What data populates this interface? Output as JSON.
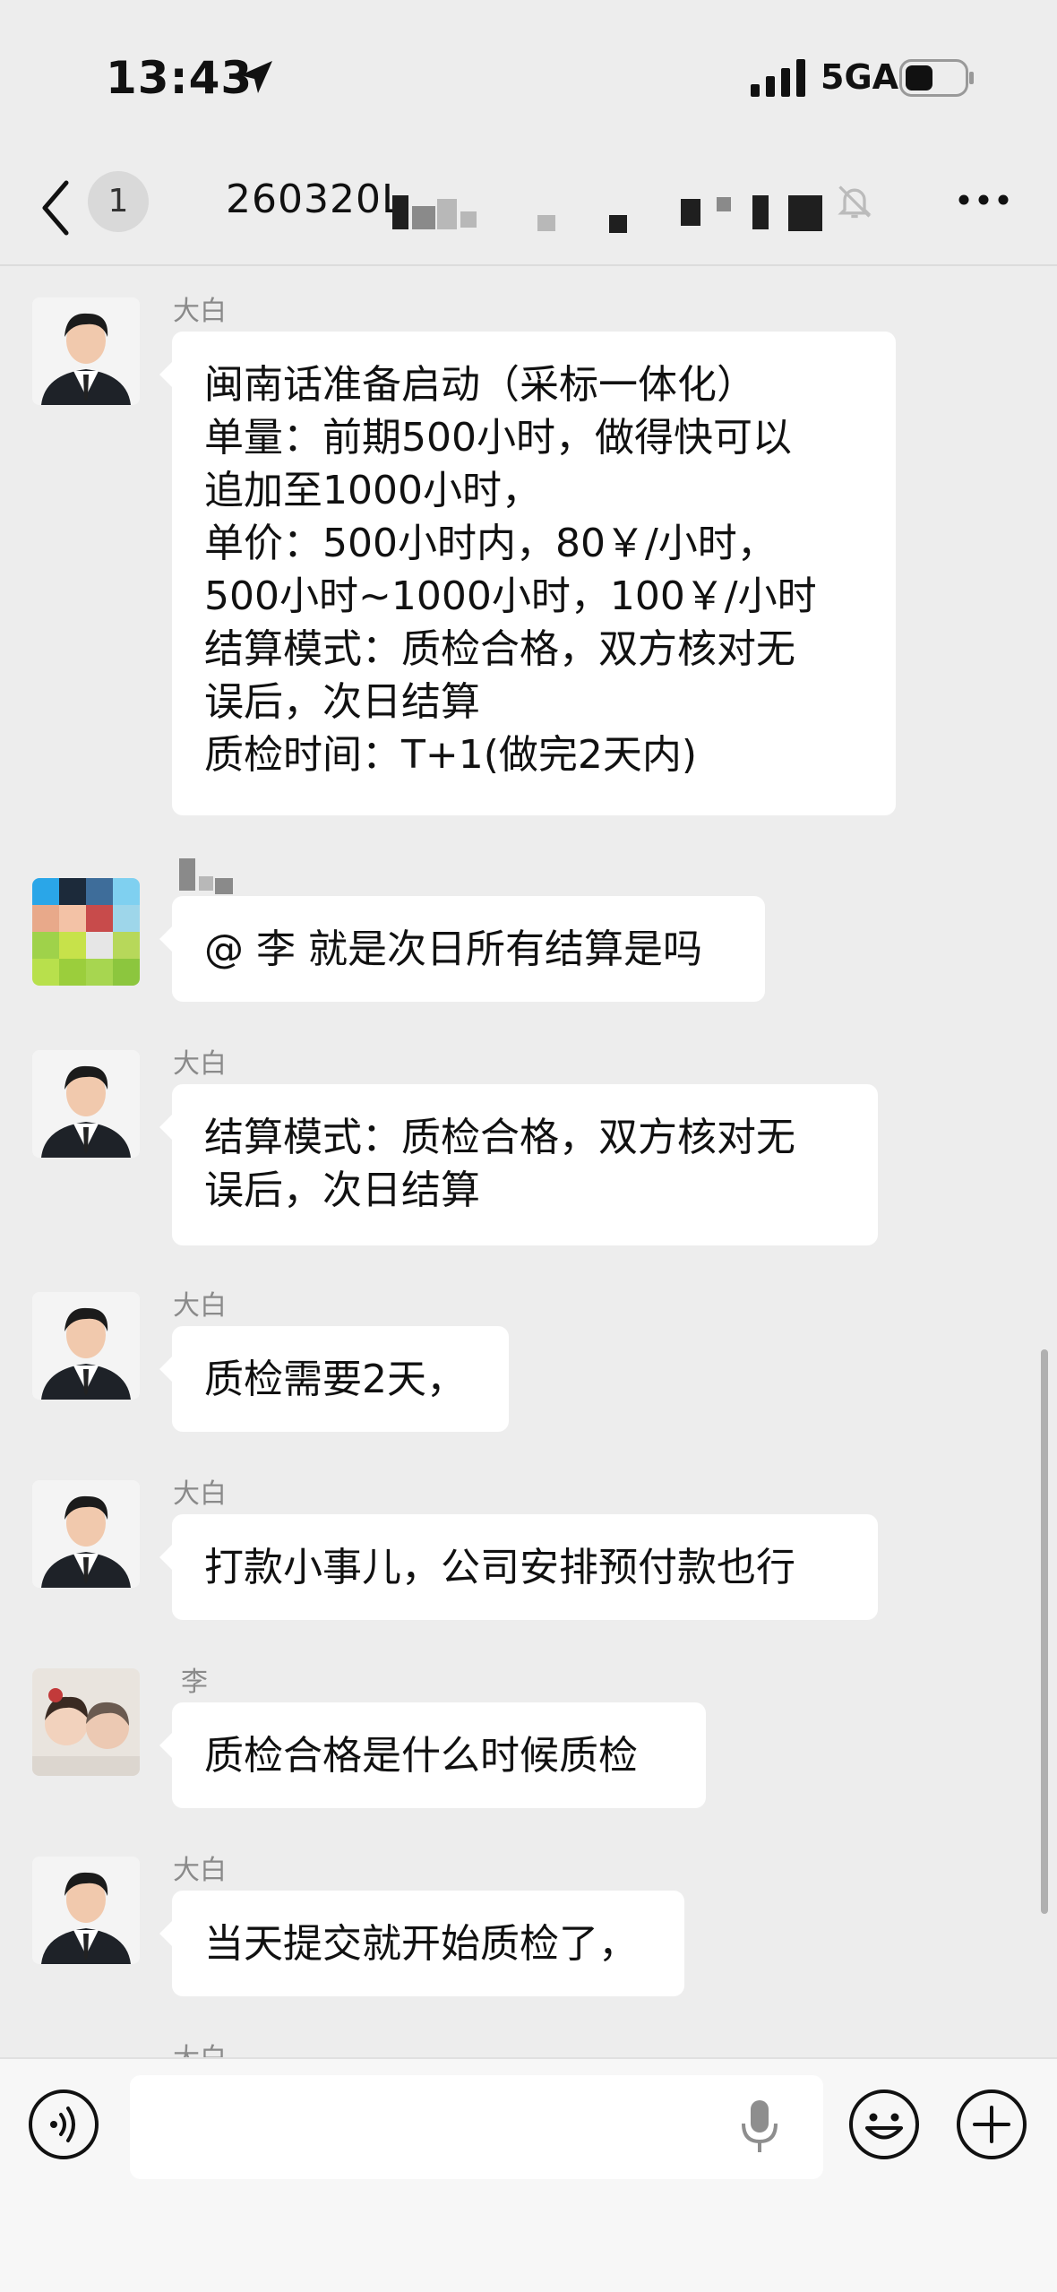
{
  "status_bar": {
    "time": "13:43",
    "network": "5GA",
    "icons": [
      "location-arrow-icon",
      "signal-icon",
      "battery-icon"
    ]
  },
  "nav": {
    "unread_count": "1",
    "title": "260320L",
    "icons": [
      "back-icon",
      "mute-icon",
      "more-icon"
    ]
  },
  "messages": [
    {
      "sender": "大白",
      "lines": [
        "闽南话准备启动（采标一体化）",
        "单量：前期500小时，做得快可以",
        "追加至1000小时，",
        "单价：500小时内，80￥/小时，",
        "500小时~1000小时，100￥/小时",
        "结算模式：质检合格，双方核对无",
        "误后，次日结算",
        "质检时间：T+1(做完2天内)"
      ]
    },
    {
      "sender": "",
      "lines": [
        "@ 李 就是次日所有结算是吗"
      ]
    },
    {
      "sender": "大白",
      "lines": [
        "结算模式：质检合格，双方核对无",
        "误后，次日结算"
      ]
    },
    {
      "sender": "大白",
      "lines": [
        "质检需要2天，"
      ]
    },
    {
      "sender": "大白",
      "lines": [
        "打款小事儿，公司安排预付款也行"
      ]
    },
    {
      "sender": "李",
      "lines": [
        "质检合格是什么时候质检"
      ]
    },
    {
      "sender": "大白",
      "lines": [
        "当天提交就开始质检了，"
      ]
    },
    {
      "sender": "大白",
      "lines": []
    }
  ],
  "input_bar": {
    "placeholder": "",
    "icons": [
      "voice-icon",
      "microphone-icon",
      "emoji-icon",
      "plus-icon"
    ]
  },
  "colors": {
    "background": "#ededed",
    "bubble": "#ffffff",
    "sender": "#8a8a8a"
  }
}
